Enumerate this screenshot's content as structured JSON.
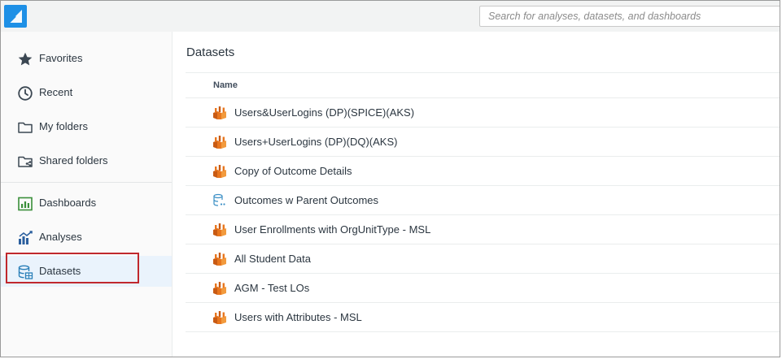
{
  "header": {
    "logo": "quicksight-logo",
    "search": {
      "placeholder": "Search for analyses, datasets, and dashboards",
      "value": ""
    }
  },
  "sidebar": {
    "items": [
      {
        "label": "Favorites",
        "icon": "star-icon"
      },
      {
        "label": "Recent",
        "icon": "clock-icon"
      },
      {
        "label": "My folders",
        "icon": "folder-icon"
      },
      {
        "label": "Shared folders",
        "icon": "shared-folder-icon"
      },
      {
        "label": "Dashboards",
        "icon": "dashboard-icon"
      },
      {
        "label": "Analyses",
        "icon": "analyses-icon"
      },
      {
        "label": "Datasets",
        "icon": "datasets-icon",
        "active": true
      }
    ]
  },
  "main": {
    "title": "Datasets",
    "table": {
      "columns": [
        "Name"
      ],
      "rows": [
        {
          "name": "Users&UserLogins (DP)(SPICE)(AKS)",
          "icon": "spice-dataset-icon"
        },
        {
          "name": "Users+UserLogins (DP)(DQ)(AKS)",
          "icon": "spice-dataset-icon"
        },
        {
          "name": "Copy of Outcome Details",
          "icon": "spice-dataset-icon"
        },
        {
          "name": "Outcomes w Parent Outcomes",
          "icon": "direct-query-dataset-icon"
        },
        {
          "name": "User Enrollments with OrgUnitType - MSL",
          "icon": "spice-dataset-icon"
        },
        {
          "name": "All Student Data",
          "icon": "spice-dataset-icon"
        },
        {
          "name": "AGM - Test LOs",
          "icon": "spice-dataset-icon"
        },
        {
          "name": "Users with Attributes - MSL",
          "icon": "spice-dataset-icon"
        }
      ]
    }
  },
  "colors": {
    "accent": "#1e90e6",
    "highlight": "#c0282d",
    "spice_icon": "#e8761e",
    "dq_icon": "#3b8fc5",
    "active_bg": "#eaf3fc"
  }
}
